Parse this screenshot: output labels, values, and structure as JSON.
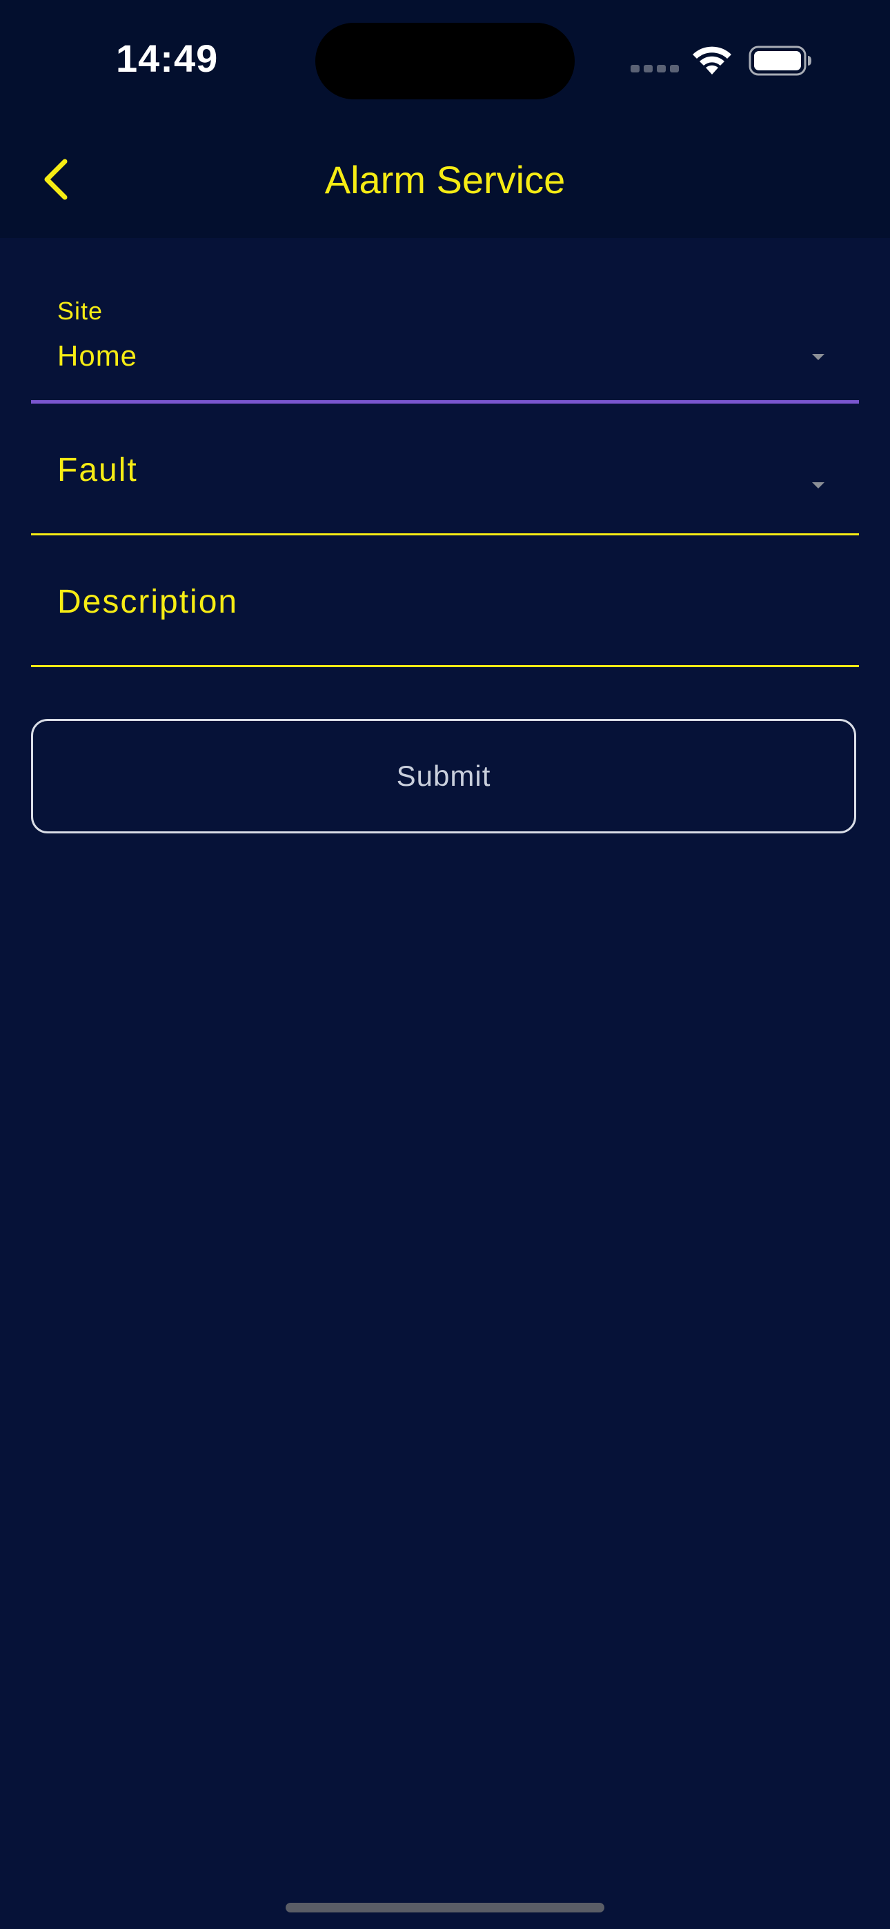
{
  "status_bar": {
    "time": "14:49",
    "icons": [
      "cellular-signal-icon",
      "wifi-icon",
      "battery-icon"
    ]
  },
  "app_bar": {
    "back_icon": "chevron-left-icon",
    "title": "Alarm Service"
  },
  "form": {
    "site": {
      "label": "Site",
      "value": "Home",
      "icon": "dropdown-arrow-icon"
    },
    "fault": {
      "label": "Fault",
      "value": "",
      "icon": "dropdown-arrow-icon"
    },
    "description": {
      "label": "Description",
      "value": ""
    },
    "submit_label": "Submit"
  },
  "colors": {
    "background": "#061238",
    "app_bar_background": "#030f2e",
    "accent_yellow": "#f6ec14",
    "focused_underline": "#7a56cf",
    "button_border": "#d9dde6"
  }
}
